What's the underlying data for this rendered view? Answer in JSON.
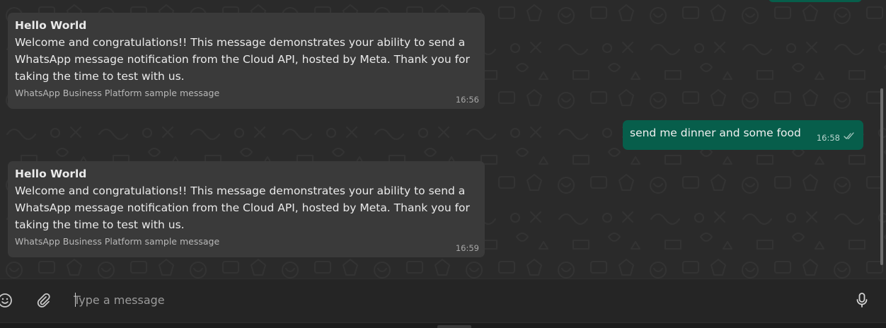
{
  "messages_in": [
    {
      "title": "Hello World",
      "body": "Welcome and congratulations!! This message demonstrates your ability to send a WhatsApp message notification from the Cloud API, hosted by Meta. Thank you for taking the time to test with us.",
      "footer": "WhatsApp Business Platform sample message",
      "time": "16:56"
    },
    {
      "title": "Hello World",
      "body": "Welcome and congratulations!! This message demonstrates your ability to send a WhatsApp message notification from the Cloud API, hosted by Meta. Thank you for taking the time to test with us.",
      "footer": "WhatsApp Business Platform sample message",
      "time": "16:59"
    }
  ],
  "message_out": {
    "text": "send me dinner and some food",
    "time": "16:58",
    "status_icon": "double-check-icon"
  },
  "composer": {
    "placeholder": "Type a message",
    "value": "",
    "emoji_icon": "emoji-icon",
    "attach_icon": "paperclip-icon",
    "mic_icon": "microphone-icon"
  },
  "colors": {
    "chat_background": "#2a2a2a",
    "incoming_bubble": "#3a3a3a",
    "outgoing_bubble": "#075e4b",
    "composer_background": "#252525"
  }
}
